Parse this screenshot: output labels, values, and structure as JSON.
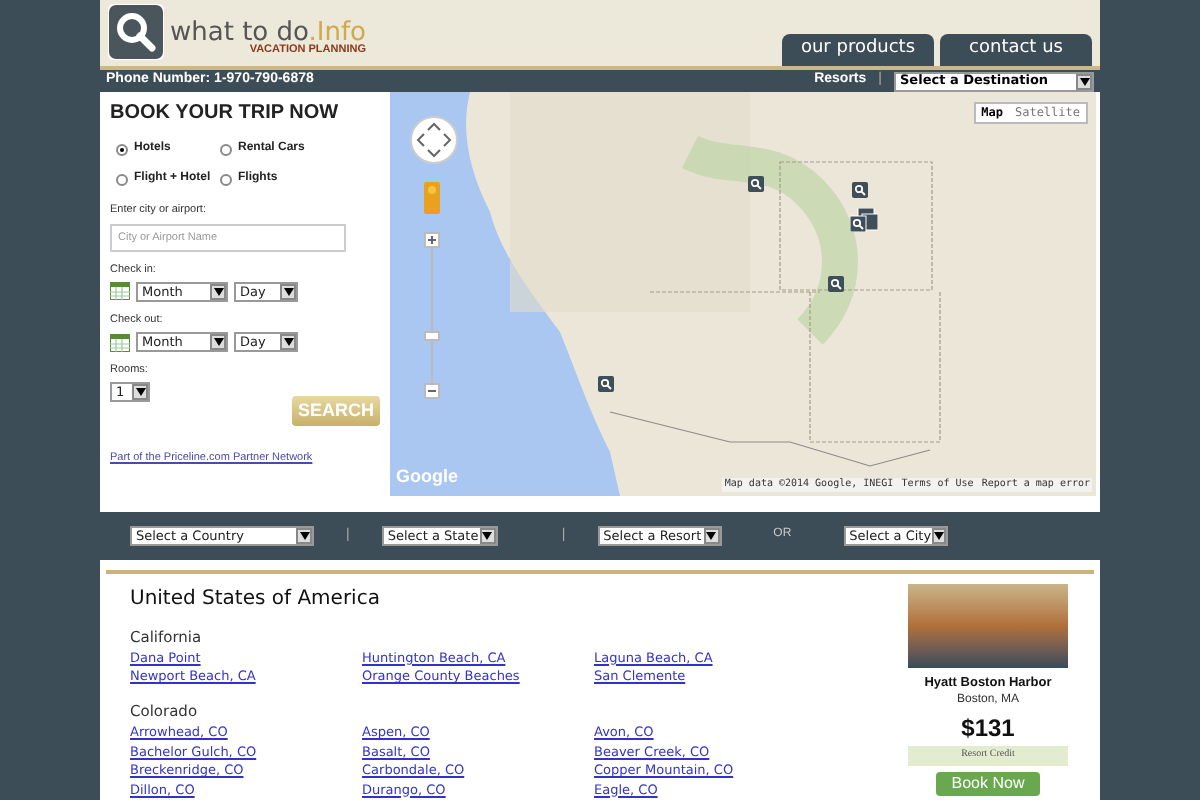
{
  "header": {
    "logo_main": "what to do",
    "logo_accent": ".Info",
    "logo_tagline": "VACATION PLANNING",
    "tabs": [
      {
        "label": "our products",
        "selected": false
      },
      {
        "label": "contact us",
        "selected": false
      }
    ]
  },
  "topbar": {
    "phone": "Phone Number: 1-970-790-6878",
    "link": "Resorts",
    "separator": "|",
    "destination": "Select a Destination"
  },
  "booking": {
    "title": "BOOK YOUR TRIP NOW",
    "options": [
      {
        "label": "Hotels",
        "selected": true
      },
      {
        "label": "Rental Cars",
        "selected": false
      },
      {
        "label": "Flight + Hotel",
        "selected": false
      },
      {
        "label": "Flights",
        "selected": false
      }
    ],
    "city_label": "Enter city or airport:",
    "city_placeholder": "City or Airport Name",
    "checkin_label": "Check in:",
    "checkin_month": "Month",
    "checkin_day": "Day",
    "checkout_label": "Check out:",
    "checkout_month": "Month",
    "checkout_day": "Day",
    "rooms_label": "Rooms:",
    "rooms": "1",
    "search": "SEARCH",
    "footer_link": "Part of the Priceline.com Partner Network"
  },
  "map": {
    "logo": "Google",
    "map_types": [
      {
        "label": "Map",
        "selected": true
      },
      {
        "label": "Satellite",
        "selected": false
      }
    ],
    "attribution": "Map data ©2014 Google, INEGI",
    "terms": "Terms of Use",
    "report": "Report a map error"
  },
  "filters": {
    "country": "Select a Country",
    "state": "Select a State",
    "resort": "Select a Resort",
    "or": "OR",
    "city": "Select a City",
    "separator": "|"
  },
  "listing": {
    "country": "United States of America",
    "states": [
      {
        "name": "California",
        "links": [
          "Dana Point",
          "Huntington Beach, CA",
          "Laguna Beach, CA",
          "Newport Beach, CA",
          "Orange County Beaches",
          "San Clemente"
        ]
      },
      {
        "name": "Colorado",
        "links": [
          "Arrowhead, CO",
          "Aspen, CO",
          "Avon, CO",
          "Bachelor Gulch, CO",
          "Basalt, CO",
          "Beaver Creek, CO",
          "Breckenridge, CO",
          "Carbondale, CO",
          "Copper Mountain, CO",
          "Dillon, CO",
          "Durango, CO",
          "Eagle, CO"
        ]
      }
    ]
  },
  "hotel": {
    "name": "Hyatt Boston Harbor",
    "location": "Boston, MA",
    "price": "$131",
    "credit": "Resort Credit",
    "button": "Book Now"
  }
}
